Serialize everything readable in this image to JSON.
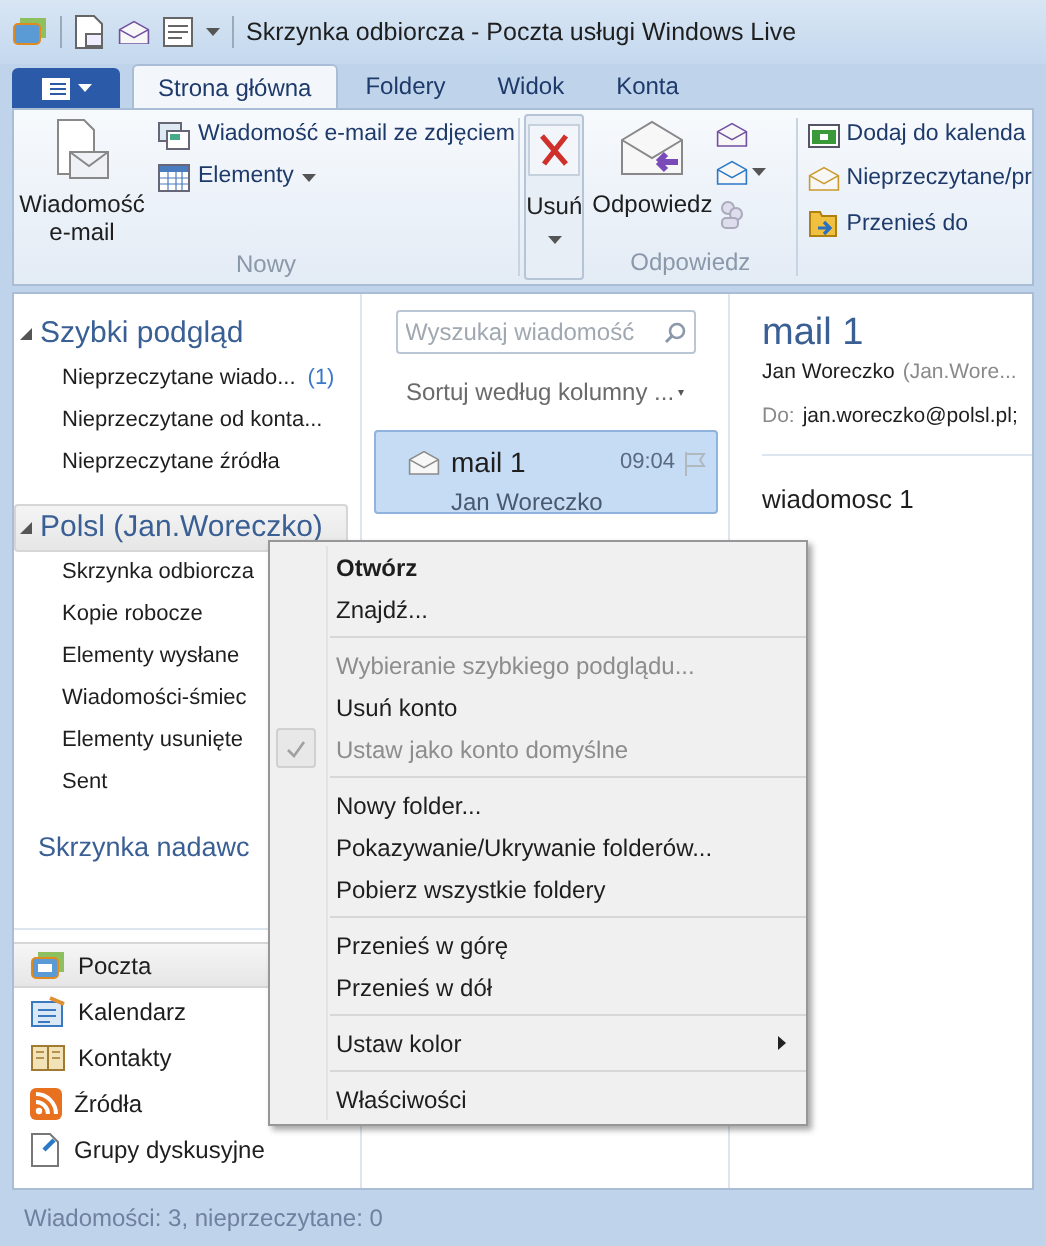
{
  "window": {
    "title": "Skrzynka odbiorcza - Poczta usługi Windows Live"
  },
  "ribbon": {
    "tabs": [
      {
        "label": "Strona główna",
        "selected": true
      },
      {
        "label": "Foldery",
        "selected": false
      },
      {
        "label": "Widok",
        "selected": false
      },
      {
        "label": "Konta",
        "selected": false
      }
    ],
    "new_group": {
      "label": "Nowy",
      "large": "Wiadomość e-mail",
      "small": [
        "Wiadomość e-mail ze zdjęciem",
        "Elementy"
      ]
    },
    "delete": {
      "label": "Usuń"
    },
    "reply_group": {
      "label": "Odpowiedz",
      "large": "Odpowiedz"
    },
    "actions_group": {
      "small": [
        "Dodaj do kalenda",
        "Nieprzeczytane/pr",
        "Przenieś do"
      ]
    }
  },
  "sidebar": {
    "sections": [
      {
        "title": "Szybki podgląd",
        "expanded": true,
        "selected": false,
        "items": [
          {
            "label": "Nieprzeczytane wiado...",
            "count": "(1)",
            "selected": false
          },
          {
            "label": "Nieprzeczytane od konta...",
            "selected": false
          },
          {
            "label": "Nieprzeczytane źródła",
            "selected": false
          }
        ]
      },
      {
        "title": "Polsl (Jan.Woreczko)",
        "expanded": true,
        "selected": true,
        "items": [
          {
            "label": "Skrzynka odbiorcza",
            "selected": false
          },
          {
            "label": "Kopie robocze",
            "selected": false
          },
          {
            "label": "Elementy wysłane",
            "selected": false
          },
          {
            "label": "Wiadomości-śmiec",
            "selected": false
          },
          {
            "label": "Elementy usunięte",
            "selected": false
          },
          {
            "label": "Sent",
            "selected": false
          }
        ]
      }
    ],
    "outbox": "Skrzynka nadawc",
    "nav": [
      {
        "label": "Poczta",
        "selected": true
      },
      {
        "label": "Kalendarz",
        "selected": false
      },
      {
        "label": "Kontakty",
        "selected": false
      },
      {
        "label": "Źródła",
        "selected": false
      },
      {
        "label": "Grupy dyskusyjne",
        "selected": false
      }
    ]
  },
  "message_list": {
    "search": {
      "placeholder": "Wyszukaj wiadomość"
    },
    "sort": "Sortuj według kolumny ...",
    "messages": [
      {
        "subject": "mail 1",
        "sender": "Jan Woreczko",
        "time": "09:04",
        "selected": true
      }
    ]
  },
  "reading_pane": {
    "subject": "mail 1",
    "from_name": "Jan Woreczko",
    "from_address": "(Jan.Wore...",
    "to_label": "Do:",
    "to": "jan.woreczko@polsl.pl;",
    "body": "wiadomosc 1"
  },
  "context_menu": {
    "groups": [
      [
        {
          "label": "Otwórz",
          "bold": true,
          "disabled": false,
          "checked": false
        },
        {
          "label": "Znajdź...",
          "disabled": false,
          "checked": false
        }
      ],
      [
        {
          "label": "Wybieranie szybkiego podglądu...",
          "disabled": true,
          "checked": false
        },
        {
          "label": "Usuń konto",
          "disabled": false,
          "checked": false
        },
        {
          "label": "Ustaw jako konto domyślne",
          "disabled": true,
          "checked": true
        }
      ],
      [
        {
          "label": "Nowy folder...",
          "disabled": false,
          "checked": false
        },
        {
          "label": "Pokazywanie/Ukrywanie folderów...",
          "disabled": false,
          "checked": false
        },
        {
          "label": "Pobierz wszystkie foldery",
          "disabled": false,
          "checked": false
        }
      ],
      [
        {
          "label": "Przenieś w górę",
          "disabled": false,
          "checked": false
        },
        {
          "label": "Przenieś w dół",
          "disabled": false,
          "checked": false
        }
      ],
      [
        {
          "label": "Ustaw kolor",
          "submenu": true,
          "disabled": false,
          "checked": false
        }
      ],
      [
        {
          "label": "Właściwości",
          "disabled": false,
          "checked": false
        }
      ]
    ]
  },
  "status_bar": {
    "text": "Wiadomości: 3, nieprzeczytane: 0"
  }
}
